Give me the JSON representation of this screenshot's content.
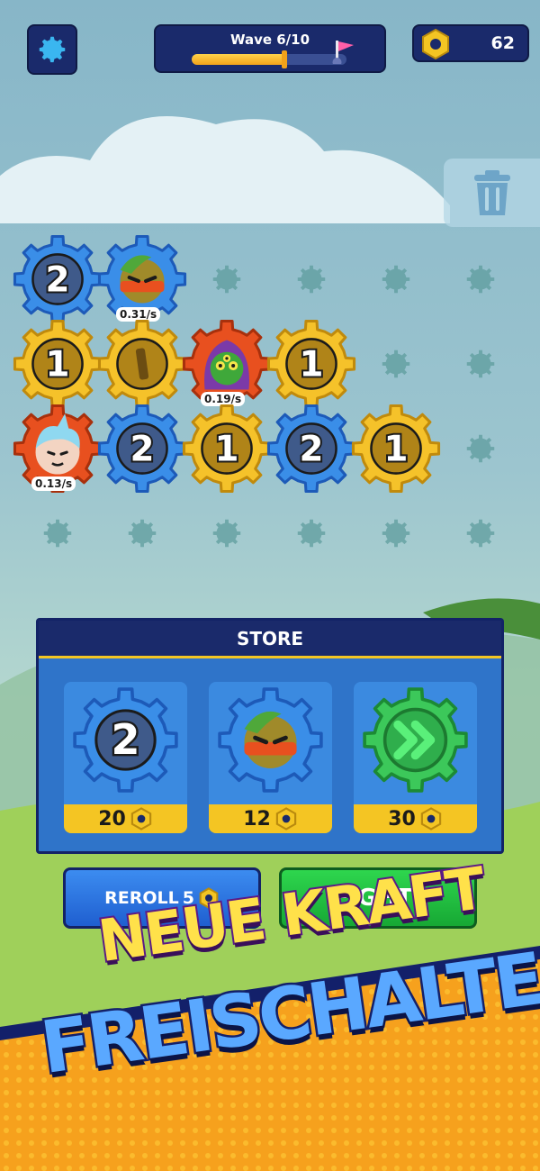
{
  "hud": {
    "wave_label": "Wave 6/10",
    "wave_progress": 0.6,
    "coins": "62"
  },
  "board": {
    "gears": [
      {
        "id": "r1c1",
        "color": "blue",
        "value": "2"
      },
      {
        "id": "r1c2",
        "color": "blue",
        "hero": "leaf-ninja",
        "rate": "0.31/s"
      },
      {
        "id": "r2c1",
        "color": "yellow",
        "value": "1"
      },
      {
        "id": "r2c2",
        "color": "yellow",
        "value": "1",
        "rotated": true
      },
      {
        "id": "r2c3",
        "color": "red",
        "hero": "green-hooded",
        "rate": "0.19/s"
      },
      {
        "id": "r2c4",
        "color": "yellow",
        "value": "1"
      },
      {
        "id": "r3c1",
        "color": "red",
        "hero": "ice-boy",
        "rate": "0.13/s"
      },
      {
        "id": "r3c2",
        "color": "blue",
        "value": "2"
      },
      {
        "id": "r3c3",
        "color": "yellow",
        "value": "1"
      },
      {
        "id": "r3c4",
        "color": "blue",
        "value": "2"
      },
      {
        "id": "r3c5",
        "color": "yellow",
        "value": "1"
      }
    ]
  },
  "store": {
    "title": "STORE",
    "items": [
      {
        "kind": "gear",
        "color": "blue",
        "value": "2",
        "price": "20"
      },
      {
        "kind": "hero",
        "color": "blue",
        "hero": "leaf-ninja",
        "price": "12"
      },
      {
        "kind": "speed",
        "color": "green",
        "icon": "fast-forward-icon",
        "price": "30"
      }
    ]
  },
  "buttons": {
    "reroll_label": "REROLL",
    "reroll_cost": "5",
    "fight_label": "FIGHT!"
  },
  "banner": {
    "line1": "NEUE KRAFT",
    "line2": "FREISCHALTEN"
  },
  "colors": {
    "gear_blue": "#3a8ee8",
    "gear_yellow": "#f5c22a",
    "gear_red": "#e8501f",
    "gear_green": "#3cc85a",
    "panel_navy": "#1a2a6b",
    "coin_gold": "#f4c523"
  }
}
